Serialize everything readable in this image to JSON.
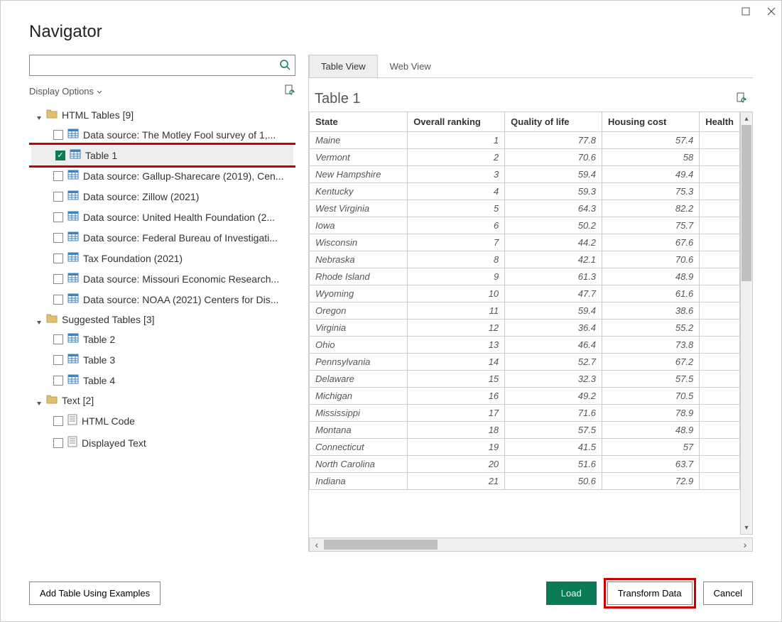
{
  "title": "Navigator",
  "search": {
    "placeholder": ""
  },
  "display_options_label": "Display Options",
  "tree": {
    "groups": [
      {
        "label": "HTML Tables [9]",
        "items": [
          {
            "label": "Data source: The Motley Fool survey of 1,...",
            "checked": false,
            "type": "table"
          },
          {
            "label": "Table 1",
            "checked": true,
            "type": "table",
            "selected": true,
            "highlighted": true
          },
          {
            "label": "Data source: Gallup-Sharecare (2019), Cen...",
            "checked": false,
            "type": "table"
          },
          {
            "label": "Data source: Zillow (2021)",
            "checked": false,
            "type": "table"
          },
          {
            "label": "Data source: United Health Foundation (2...",
            "checked": false,
            "type": "table"
          },
          {
            "label": "Data source: Federal Bureau of Investigati...",
            "checked": false,
            "type": "table"
          },
          {
            "label": "Tax Foundation (2021)",
            "checked": false,
            "type": "table"
          },
          {
            "label": "Data source: Missouri Economic Research...",
            "checked": false,
            "type": "table"
          },
          {
            "label": "Data source: NOAA (2021) Centers for Dis...",
            "checked": false,
            "type": "table"
          }
        ]
      },
      {
        "label": "Suggested Tables [3]",
        "items": [
          {
            "label": "Table 2",
            "checked": false,
            "type": "table"
          },
          {
            "label": "Table 3",
            "checked": false,
            "type": "table"
          },
          {
            "label": "Table 4",
            "checked": false,
            "type": "table"
          }
        ]
      },
      {
        "label": "Text [2]",
        "items": [
          {
            "label": "HTML Code",
            "checked": false,
            "type": "doc"
          },
          {
            "label": "Displayed Text",
            "checked": false,
            "type": "doc"
          }
        ]
      }
    ]
  },
  "tabs": {
    "table_view": "Table View",
    "web_view": "Web View"
  },
  "preview_title": "Table 1",
  "table": {
    "columns": [
      "State",
      "Overall ranking",
      "Quality of life",
      "Housing cost",
      "Health"
    ],
    "rows": [
      [
        "Maine",
        "1",
        "77.8",
        "57.4"
      ],
      [
        "Vermont",
        "2",
        "70.6",
        "58"
      ],
      [
        "New Hampshire",
        "3",
        "59.4",
        "49.4"
      ],
      [
        "Kentucky",
        "4",
        "59.3",
        "75.3"
      ],
      [
        "West Virginia",
        "5",
        "64.3",
        "82.2"
      ],
      [
        "Iowa",
        "6",
        "50.2",
        "75.7"
      ],
      [
        "Wisconsin",
        "7",
        "44.2",
        "67.6"
      ],
      [
        "Nebraska",
        "8",
        "42.1",
        "70.6"
      ],
      [
        "Rhode Island",
        "9",
        "61.3",
        "48.9"
      ],
      [
        "Wyoming",
        "10",
        "47.7",
        "61.6"
      ],
      [
        "Oregon",
        "11",
        "59.4",
        "38.6"
      ],
      [
        "Virginia",
        "12",
        "36.4",
        "55.2"
      ],
      [
        "Ohio",
        "13",
        "46.4",
        "73.8"
      ],
      [
        "Pennsylvania",
        "14",
        "52.7",
        "67.2"
      ],
      [
        "Delaware",
        "15",
        "32.3",
        "57.5"
      ],
      [
        "Michigan",
        "16",
        "49.2",
        "70.5"
      ],
      [
        "Mississippi",
        "17",
        "71.6",
        "78.9"
      ],
      [
        "Montana",
        "18",
        "57.5",
        "48.9"
      ],
      [
        "Connecticut",
        "19",
        "41.5",
        "57"
      ],
      [
        "North Carolina",
        "20",
        "51.6",
        "63.7"
      ],
      [
        "Indiana",
        "21",
        "50.6",
        "72.9"
      ]
    ]
  },
  "footer": {
    "add_examples": "Add Table Using Examples",
    "load": "Load",
    "transform": "Transform Data",
    "cancel": "Cancel"
  }
}
